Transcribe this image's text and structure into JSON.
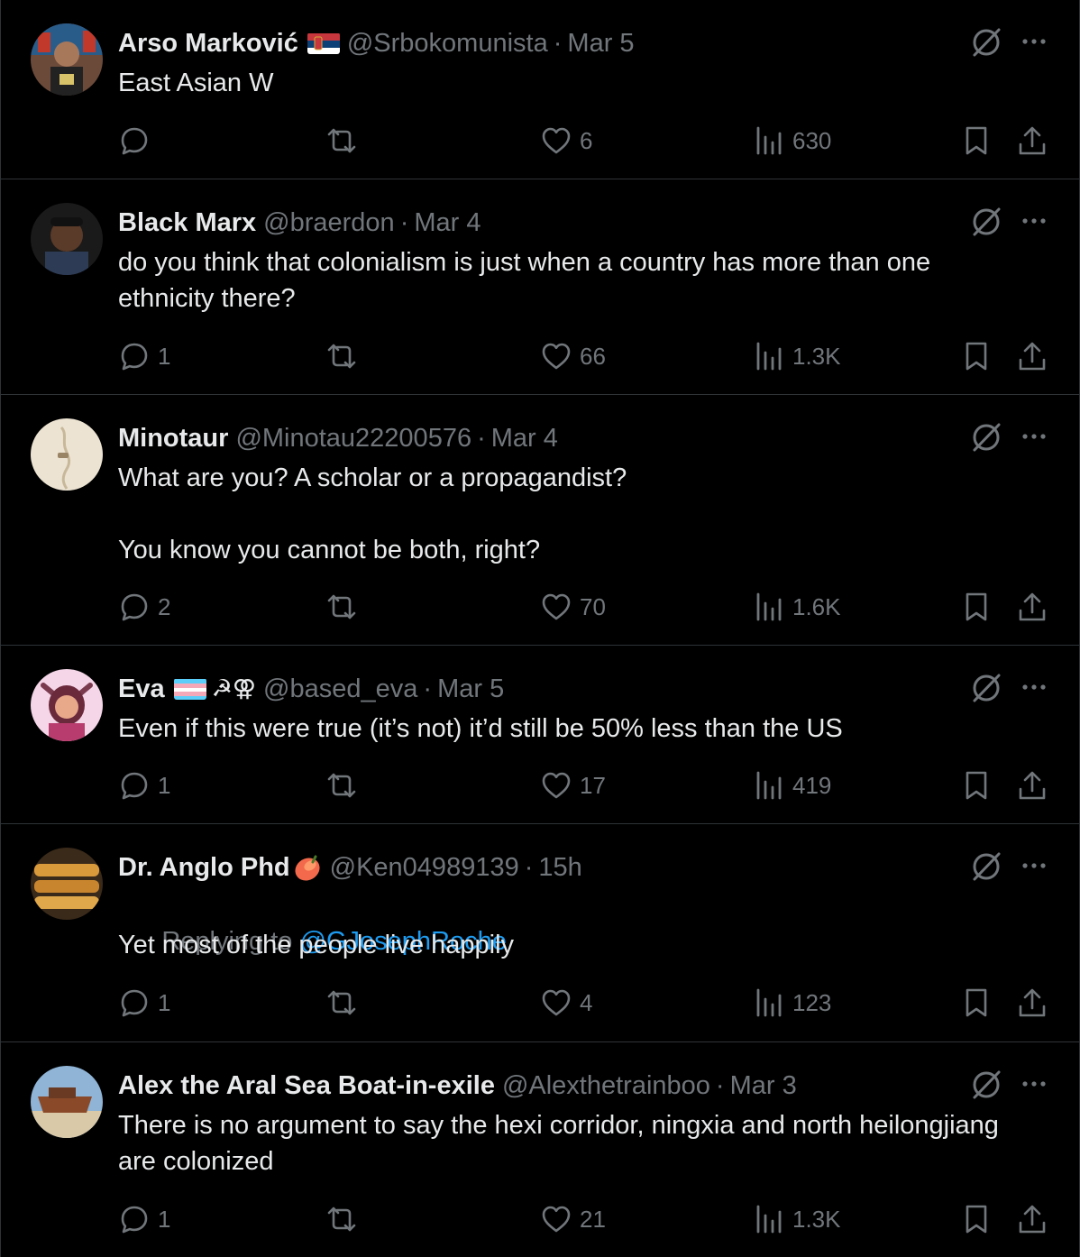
{
  "colors": {
    "background": "#000000",
    "text": "#e7e9ea",
    "muted": "#71767b",
    "link": "#1d9bf0",
    "divider": "#2f3336"
  },
  "icons": {
    "reply": "reply-icon",
    "retweet": "retweet-icon",
    "like": "heart-icon",
    "views": "views-icon",
    "bookmark": "bookmark-icon",
    "share": "share-icon",
    "grok": "grok-icon",
    "more": "more-icon"
  },
  "tweets": [
    {
      "name": "Arso Marković",
      "handle": "@Srbokomunista",
      "sep": "·",
      "date": "Mar 5",
      "text": "East Asian W",
      "replies": "",
      "likes": "6",
      "views": "630"
    },
    {
      "name": "Black Marx",
      "handle": "@braerdon",
      "sep": "·",
      "date": "Mar 4",
      "text": "do you think that colonialism is just when a country has more than one ethnicity there?",
      "replies": "1",
      "likes": "66",
      "views": "1.3K"
    },
    {
      "name": "Minotaur",
      "handle": "@Minotau22200576",
      "sep": "·",
      "date": "Mar 4",
      "text": "What are you? A scholar or a propagandist?\n\nYou know you cannot be both, right?",
      "replies": "2",
      "likes": "70",
      "views": "1.6K"
    },
    {
      "name": "Eva",
      "emoji": "☭⚢",
      "handle": "@based_eva",
      "sep": "·",
      "date": "Mar 5",
      "text": "Even if this were true (it’s not) it’d still be 50% less than the US",
      "replies": "1",
      "likes": "17",
      "views": "419"
    },
    {
      "name": "Dr. Anglo Phd",
      "emoji": "🥭",
      "handle": "@Ken04989139",
      "sep": "·",
      "date": "15h",
      "replying_prefix": "Replying to ",
      "replying_to": "@GJosephRoche",
      "text": "Yet most of the people live happily",
      "replies": "1",
      "likes": "4",
      "views": "123"
    },
    {
      "name": "Alex the Aral Sea Boat-in-exile",
      "handle": "@Alexthetrainboo",
      "sep": "·",
      "date": "Mar 3",
      "text": "There is no argument to say the hexi corridor, ningxia and north heilongjiang are colonized",
      "replies": "1",
      "likes": "21",
      "views": "1.3K"
    }
  ]
}
